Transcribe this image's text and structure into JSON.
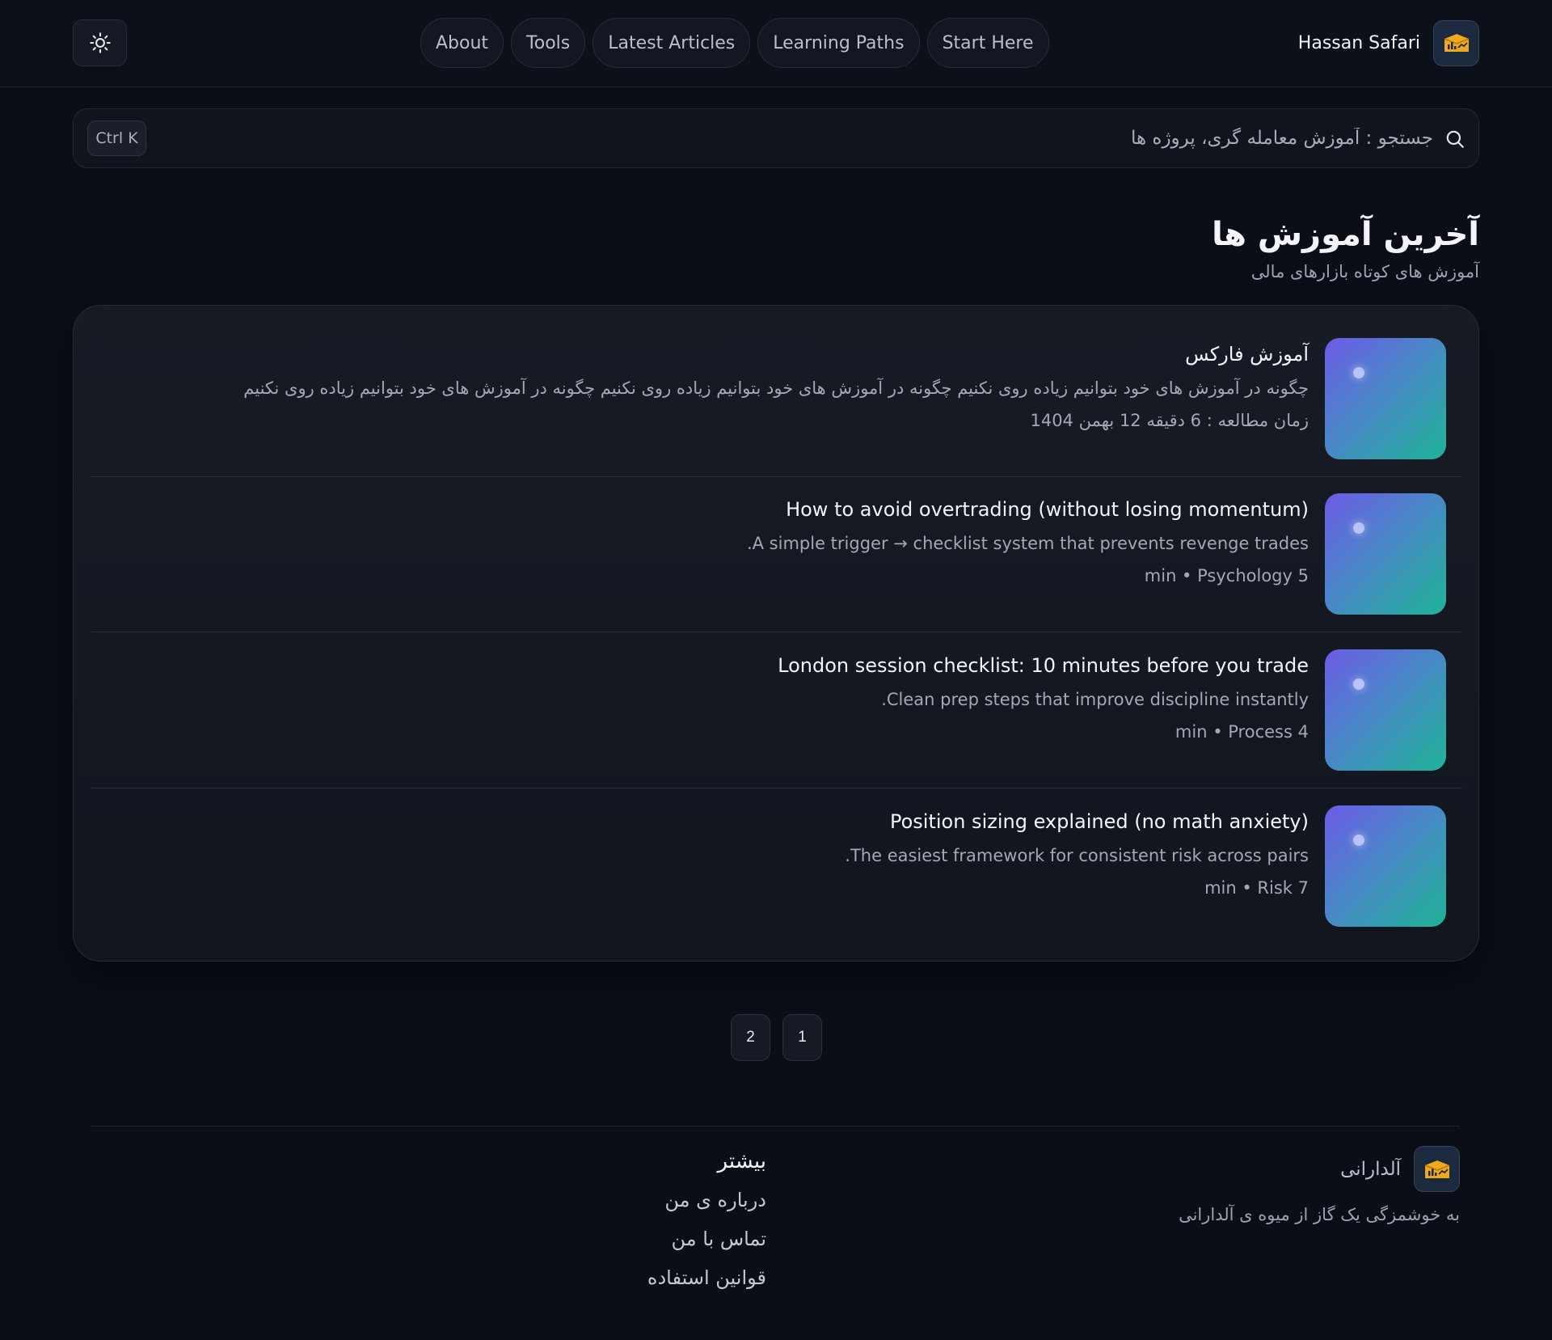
{
  "header": {
    "theme_toggle_icon": "sun-icon",
    "nav": [
      {
        "label": "About"
      },
      {
        "label": "Tools"
      },
      {
        "label": "Latest Articles"
      },
      {
        "label": "Learning Paths"
      },
      {
        "label": "Start Here"
      }
    ],
    "user_name": "Hassan Safari",
    "logo_icon": "chart-logo-icon"
  },
  "search": {
    "placeholder": "جستجو : آموزش معامله گری، پروژه ها",
    "shortcut": "Ctrl K",
    "icon": "search-icon"
  },
  "section": {
    "title": "آخرین آموزش ها",
    "subtitle": "آموزش های کوتاه بازارهای مالی"
  },
  "articles": [
    {
      "title": "آموزش فارکس",
      "description": "چگونه در آموزش های خود بتوانیم زیاده روی نکنیم چگونه در آموزش های خود بتوانیم زیاده روی نکنیم چگونه در آموزش های خود بتوانیم زیاده روی نکنیم",
      "meta": "زمان مطالعه : 6 دقیقه 12 بهمن 1404"
    },
    {
      "title": "How to avoid overtrading (without losing momentum)",
      "description": "A simple trigger → checklist system that prevents revenge trades.",
      "meta": "5 min • Psychology"
    },
    {
      "title": "London session checklist: 10 minutes before you trade",
      "description": "Clean prep steps that improve discipline instantly.",
      "meta": "4 min • Process"
    },
    {
      "title": "Position sizing explained (no math anxiety)",
      "description": "The easiest framework for consistent risk across pairs.",
      "meta": "7 min • Risk"
    }
  ],
  "pagination": {
    "pages": [
      "1",
      "2"
    ]
  },
  "footer": {
    "brand_name": "آلدارانی",
    "tagline": "به خوشمزگی یک گاز از میوه ی آلدارانی",
    "links_heading": "بیشتر",
    "links": [
      {
        "label": "درباره ی من"
      },
      {
        "label": "تماس با من"
      },
      {
        "label": "قوانین استفاده"
      }
    ]
  },
  "colors": {
    "background": "#0b0e16",
    "thumb_gradient_start": "#6d5be6",
    "thumb_gradient_end": "#1fb496",
    "logo_accent": "#f0a81c"
  }
}
